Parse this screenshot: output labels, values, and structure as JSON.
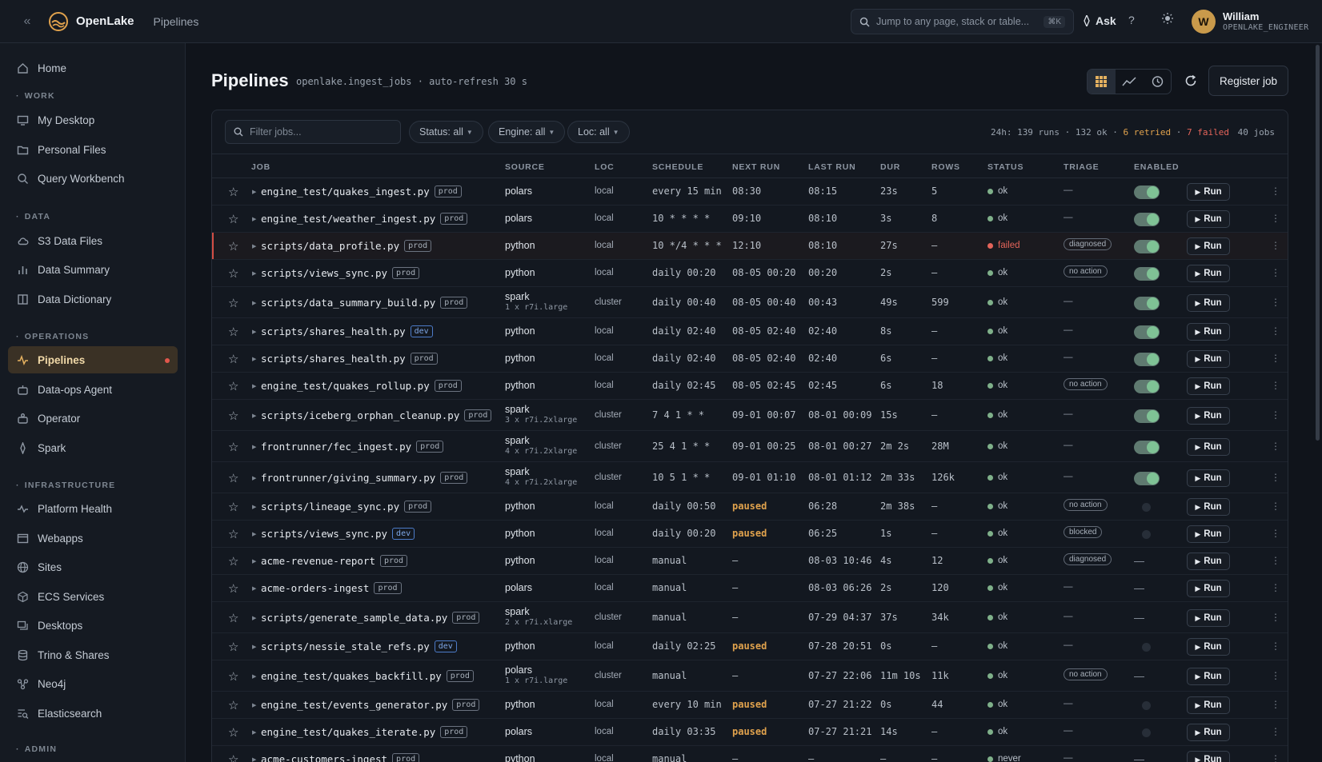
{
  "app": {
    "brand": "OpenLake",
    "breadcrumb": "Pipelines"
  },
  "topbar": {
    "search_placeholder": "Jump to any page, stack or table...",
    "search_shortcut": "⌘K",
    "ask_label": "Ask",
    "help_label": "?",
    "user": {
      "initial": "W",
      "name": "William",
      "role": "OPENLAKE_ENGINEER"
    }
  },
  "sidebar": {
    "home": "Home",
    "sections": {
      "work": "WORK",
      "data": "DATA",
      "operations": "OPERATIONS",
      "infrastructure": "INFRASTRUCTURE",
      "admin": "ADMIN"
    },
    "items": {
      "my_desktop": "My Desktop",
      "personal_files": "Personal Files",
      "query_workbench": "Query Workbench",
      "s3_data_files": "S3 Data Files",
      "data_summary": "Data Summary",
      "data_dictionary": "Data Dictionary",
      "pipelines": "Pipelines",
      "data_ops_agent": "Data-ops Agent",
      "operator": "Operator",
      "spark": "Spark",
      "platform_health": "Platform Health",
      "webapps": "Webapps",
      "sites": "Sites",
      "ecs_services": "ECS Services",
      "desktops": "Desktops",
      "trino_shares": "Trino & Shares",
      "neo4j": "Neo4j",
      "elasticsearch": "Elasticsearch"
    }
  },
  "page": {
    "title": "Pipelines",
    "subtitle": "openlake.ingest_jobs · auto-refresh 30 s",
    "register_label": "Register job"
  },
  "toolbar": {
    "filter_placeholder": "Filter jobs...",
    "status_chip": "Status: all",
    "engine_chip": "Engine: all",
    "loc_chip": "Loc: all",
    "stats": {
      "runs": "24h: 139 runs",
      "ok": "132 ok",
      "retried": "6 retried",
      "failed": "7 failed",
      "jobs": "40 jobs"
    }
  },
  "table": {
    "columns": {
      "job": "JOB",
      "source": "SOURCE",
      "loc": "LOC",
      "schedule": "SCHEDULE",
      "next_run": "NEXT RUN",
      "last_run": "LAST RUN",
      "dur": "DUR",
      "rows": "ROWS",
      "status": "STATUS",
      "triage": "TRIAGE",
      "enabled": "ENABLED"
    },
    "run_label": "Run",
    "rows": [
      {
        "job": "engine_test/quakes_ingest.py",
        "env": "prod",
        "source": "polars",
        "source_sub": "",
        "loc": "local",
        "schedule": "every 15 min",
        "next": "08:30",
        "paused": false,
        "last": "08:15",
        "dur": "23s",
        "rows": "5",
        "status": "ok",
        "triage": "—",
        "triage_pill": false,
        "enabled": "on"
      },
      {
        "job": "engine_test/weather_ingest.py",
        "env": "prod",
        "source": "polars",
        "source_sub": "",
        "loc": "local",
        "schedule": "10 * * * *",
        "next": "09:10",
        "paused": false,
        "last": "08:10",
        "dur": "3s",
        "rows": "8",
        "status": "ok",
        "triage": "—",
        "triage_pill": false,
        "enabled": "on"
      },
      {
        "job": "scripts/data_profile.py",
        "env": "prod",
        "source": "python",
        "source_sub": "",
        "loc": "local",
        "schedule": "10 */4 * * *",
        "next": "12:10",
        "paused": false,
        "last": "08:10",
        "dur": "27s",
        "rows": "—",
        "status": "failed",
        "triage": "diagnosed",
        "triage_pill": true,
        "enabled": "on"
      },
      {
        "job": "scripts/views_sync.py",
        "env": "prod",
        "source": "python",
        "source_sub": "",
        "loc": "local",
        "schedule": "daily 00:20",
        "next": "08-05 00:20",
        "paused": false,
        "last": "00:20",
        "dur": "2s",
        "rows": "—",
        "status": "ok",
        "triage": "no action",
        "triage_pill": true,
        "enabled": "on"
      },
      {
        "job": "scripts/data_summary_build.py",
        "env": "prod",
        "source": "spark",
        "source_sub": "1 x r7i.large",
        "loc": "cluster",
        "schedule": "daily 00:40",
        "next": "08-05 00:40",
        "paused": false,
        "last": "00:43",
        "dur": "49s",
        "rows": "599",
        "status": "ok",
        "triage": "—",
        "triage_pill": false,
        "enabled": "on"
      },
      {
        "job": "scripts/shares_health.py",
        "env": "dev",
        "source": "python",
        "source_sub": "",
        "loc": "local",
        "schedule": "daily 02:40",
        "next": "08-05 02:40",
        "paused": false,
        "last": "02:40",
        "dur": "8s",
        "rows": "—",
        "status": "ok",
        "triage": "—",
        "triage_pill": false,
        "enabled": "on"
      },
      {
        "job": "scripts/shares_health.py",
        "env": "prod",
        "source": "python",
        "source_sub": "",
        "loc": "local",
        "schedule": "daily 02:40",
        "next": "08-05 02:40",
        "paused": false,
        "last": "02:40",
        "dur": "6s",
        "rows": "—",
        "status": "ok",
        "triage": "—",
        "triage_pill": false,
        "enabled": "on"
      },
      {
        "job": "engine_test/quakes_rollup.py",
        "env": "prod",
        "source": "python",
        "source_sub": "",
        "loc": "local",
        "schedule": "daily 02:45",
        "next": "08-05 02:45",
        "paused": false,
        "last": "02:45",
        "dur": "6s",
        "rows": "18",
        "status": "ok",
        "triage": "no action",
        "triage_pill": true,
        "enabled": "on"
      },
      {
        "job": "scripts/iceberg_orphan_cleanup.py",
        "env": "prod",
        "source": "spark",
        "source_sub": "3 x r7i.2xlarge",
        "loc": "cluster",
        "schedule": "7 4 1 * *",
        "next": "09-01 00:07",
        "paused": false,
        "last": "08-01 00:09",
        "dur": "15s",
        "rows": "—",
        "status": "ok",
        "triage": "—",
        "triage_pill": false,
        "enabled": "on"
      },
      {
        "job": "frontrunner/fec_ingest.py",
        "env": "prod",
        "source": "spark",
        "source_sub": "4 x r7i.2xlarge",
        "loc": "cluster",
        "schedule": "25 4 1 * *",
        "next": "09-01 00:25",
        "paused": false,
        "last": "08-01 00:27",
        "dur": "2m 2s",
        "rows": "28M",
        "status": "ok",
        "triage": "—",
        "triage_pill": false,
        "enabled": "on"
      },
      {
        "job": "frontrunner/giving_summary.py",
        "env": "prod",
        "source": "spark",
        "source_sub": "4 x r7i.2xlarge",
        "loc": "cluster",
        "schedule": "10 5 1 * *",
        "next": "09-01 01:10",
        "paused": false,
        "last": "08-01 01:12",
        "dur": "2m 33s",
        "rows": "126k",
        "status": "ok",
        "triage": "—",
        "triage_pill": false,
        "enabled": "on"
      },
      {
        "job": "scripts/lineage_sync.py",
        "env": "prod",
        "source": "python",
        "source_sub": "",
        "loc": "local",
        "schedule": "daily 00:50",
        "next": "paused",
        "paused": true,
        "last": "06:28",
        "dur": "2m 38s",
        "rows": "—",
        "status": "ok",
        "triage": "no action",
        "triage_pill": true,
        "enabled": "off"
      },
      {
        "job": "scripts/views_sync.py",
        "env": "dev",
        "source": "python",
        "source_sub": "",
        "loc": "local",
        "schedule": "daily 00:20",
        "next": "paused",
        "paused": true,
        "last": "06:25",
        "dur": "1s",
        "rows": "—",
        "status": "ok",
        "triage": "blocked",
        "triage_pill": true,
        "enabled": "off"
      },
      {
        "job": "acme-revenue-report",
        "env": "prod",
        "source": "python",
        "source_sub": "",
        "loc": "local",
        "schedule": "manual",
        "next": "—",
        "paused": false,
        "last": "08-03 10:46",
        "dur": "4s",
        "rows": "12",
        "status": "ok",
        "triage": "diagnosed",
        "triage_pill": true,
        "enabled": "dash"
      },
      {
        "job": "acme-orders-ingest",
        "env": "prod",
        "source": "polars",
        "source_sub": "",
        "loc": "local",
        "schedule": "manual",
        "next": "—",
        "paused": false,
        "last": "08-03 06:26",
        "dur": "2s",
        "rows": "120",
        "status": "ok",
        "triage": "—",
        "triage_pill": false,
        "enabled": "dash"
      },
      {
        "job": "scripts/generate_sample_data.py",
        "env": "prod",
        "source": "spark",
        "source_sub": "2 x r7i.xlarge",
        "loc": "cluster",
        "schedule": "manual",
        "next": "—",
        "paused": false,
        "last": "07-29 04:37",
        "dur": "37s",
        "rows": "34k",
        "status": "ok",
        "triage": "—",
        "triage_pill": false,
        "enabled": "dash"
      },
      {
        "job": "scripts/nessie_stale_refs.py",
        "env": "dev",
        "source": "python",
        "source_sub": "",
        "loc": "local",
        "schedule": "daily 02:25",
        "next": "paused",
        "paused": true,
        "last": "07-28 20:51",
        "dur": "0s",
        "rows": "—",
        "status": "ok",
        "triage": "—",
        "triage_pill": false,
        "enabled": "off"
      },
      {
        "job": "engine_test/quakes_backfill.py",
        "env": "prod",
        "source": "polars",
        "source_sub": "1 x r7i.large",
        "loc": "cluster",
        "schedule": "manual",
        "next": "—",
        "paused": false,
        "last": "07-27 22:06",
        "dur": "11m 10s",
        "rows": "11k",
        "status": "ok",
        "triage": "no action",
        "triage_pill": true,
        "enabled": "dash"
      },
      {
        "job": "engine_test/events_generator.py",
        "env": "prod",
        "source": "python",
        "source_sub": "",
        "loc": "local",
        "schedule": "every 10 min",
        "next": "paused",
        "paused": true,
        "last": "07-27 21:22",
        "dur": "0s",
        "rows": "44",
        "status": "ok",
        "triage": "—",
        "triage_pill": false,
        "enabled": "off"
      },
      {
        "job": "engine_test/quakes_iterate.py",
        "env": "prod",
        "source": "polars",
        "source_sub": "",
        "loc": "local",
        "schedule": "daily 03:35",
        "next": "paused",
        "paused": true,
        "last": "07-27 21:21",
        "dur": "14s",
        "rows": "—",
        "status": "ok",
        "triage": "—",
        "triage_pill": false,
        "enabled": "off"
      },
      {
        "job": "acme-customers-ingest",
        "env": "prod",
        "source": "python",
        "source_sub": "",
        "loc": "local",
        "schedule": "manual",
        "next": "—",
        "paused": false,
        "last": "—",
        "dur": "—",
        "rows": "—",
        "status": "never",
        "triage": "—",
        "triage_pill": false,
        "enabled": "dash"
      }
    ]
  }
}
